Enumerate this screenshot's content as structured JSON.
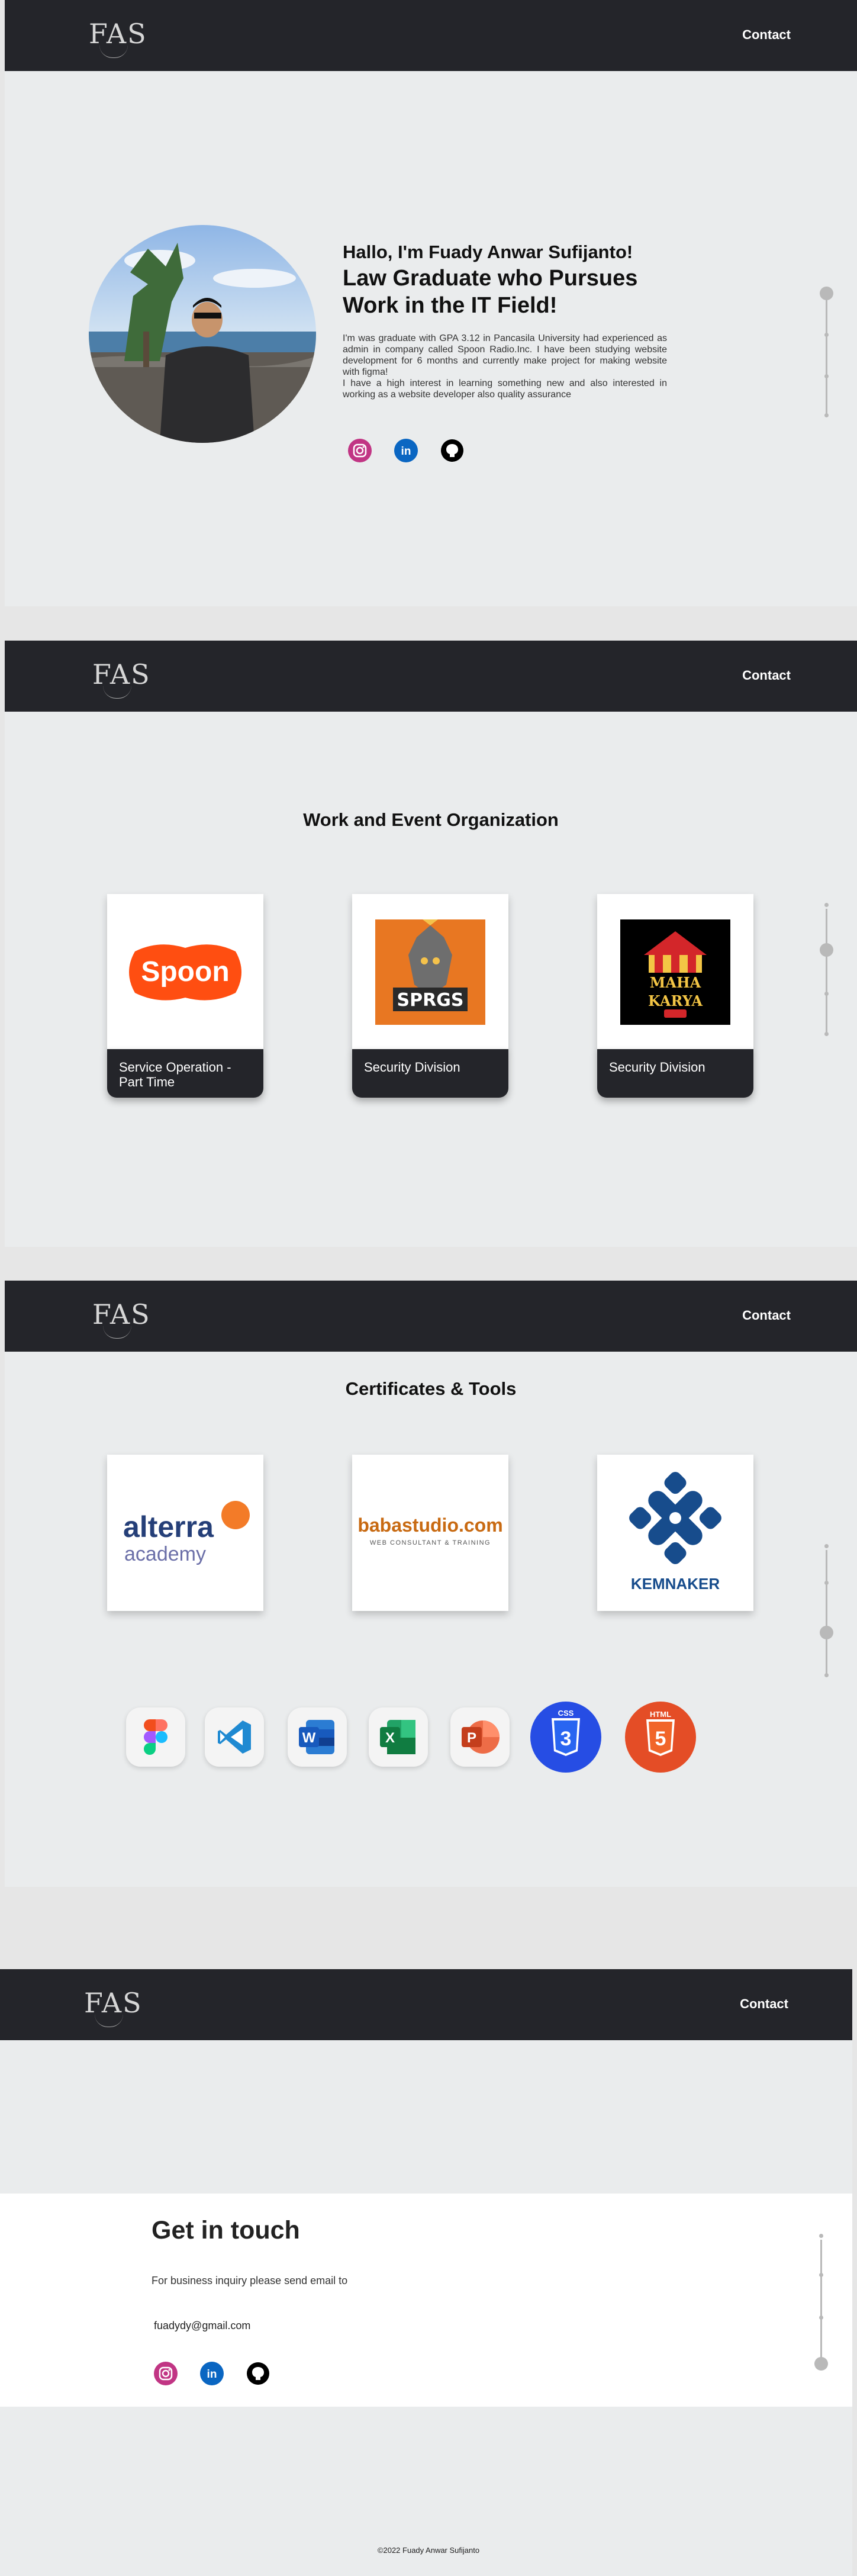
{
  "brand": {
    "logo_text": "FAS"
  },
  "nav": {
    "contact_label": "Contact"
  },
  "hero": {
    "greeting": "Hallo, I'm Fuady Anwar Sufijanto!",
    "headline": "Law Graduate who Pursues Work in the IT Field!",
    "bio_1": "I'm was graduate with GPA 3.12 in Pancasila University had experienced as admin in company called Spoon Radio.Inc. I have been studying website development for 6 months and currently make project for making website with figma!",
    "bio_2": "I have a high interest in learning something new and also interested in working as a website developer also quality assurance"
  },
  "work": {
    "title": "Work and Event Organization",
    "cards": [
      {
        "logo": "Spoon",
        "label": "Service Operation - Part Time"
      },
      {
        "logo": "SPRGS",
        "label": "Security Division"
      },
      {
        "logo": "MAHA KARYA",
        "label": "Security Division"
      }
    ]
  },
  "certs": {
    "title": "Certificates & Tools",
    "cards": [
      {
        "logo_main": "alterra",
        "logo_sub": "academy"
      },
      {
        "logo_main": "babastudio.com",
        "logo_sub": "WEB CONSULTANT & TRAINING"
      },
      {
        "logo_main": "KEMNAKER"
      }
    ],
    "tools": [
      {
        "icon": "figma-icon"
      },
      {
        "icon": "vscode-icon"
      },
      {
        "icon": "word-icon",
        "letter": "W"
      },
      {
        "icon": "excel-icon",
        "letter": "X"
      },
      {
        "icon": "powerpoint-icon",
        "letter": "P"
      },
      {
        "icon": "css3-icon",
        "text": "CSS",
        "number": "3"
      },
      {
        "icon": "html5-icon",
        "text": "HTML",
        "number": "5"
      }
    ]
  },
  "contact": {
    "title": "Get in touch",
    "description": "For business inquiry please send email to",
    "email": "fuadydy@gmail.com"
  },
  "footer": {
    "text": "©2022 Fuady Anwar Sufijanto"
  },
  "colors": {
    "nav_bg": "#24252a",
    "section_bg": "#eaeced",
    "instagram": "#c13584",
    "linkedin": "#0a66c2",
    "github": "#000000"
  }
}
